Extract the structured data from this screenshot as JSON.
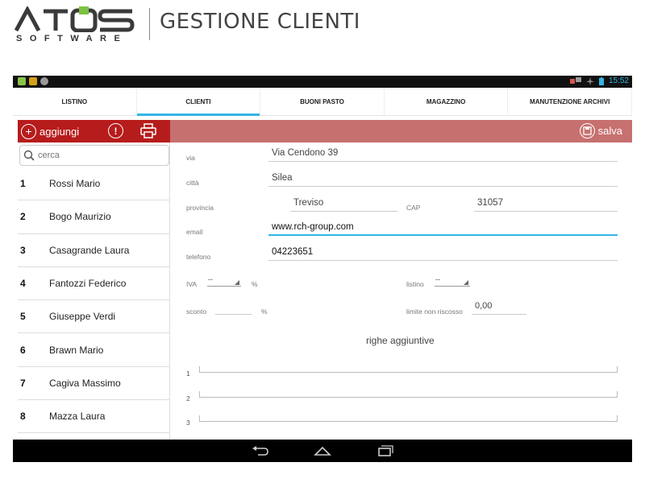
{
  "banner": {
    "logo_top": "ATOS",
    "logo_bottom": "SOFTWARE",
    "title": "GESTIONE CLIENTI"
  },
  "statusbar": {
    "time": "15:52"
  },
  "tabs": [
    {
      "label": "LISTINO",
      "active": false
    },
    {
      "label": "CLIENTI",
      "active": true
    },
    {
      "label": "BUONI PASTO",
      "active": false
    },
    {
      "label": "MAGAZZINO",
      "active": false
    },
    {
      "label": "MANUTENZIONE ARCHIVI",
      "active": false
    }
  ],
  "toolbar": {
    "add_label": "aggiungi",
    "save_label": "salva"
  },
  "search": {
    "placeholder": "cerca"
  },
  "clients": [
    {
      "num": "1",
      "name": "Rossi Mario"
    },
    {
      "num": "2",
      "name": "Bogo Maurizio"
    },
    {
      "num": "3",
      "name": "Casagrande Laura"
    },
    {
      "num": "4",
      "name": "Fantozzi Federico"
    },
    {
      "num": "5",
      "name": "Giuseppe Verdi"
    },
    {
      "num": "6",
      "name": "Brawn Mario"
    },
    {
      "num": "7",
      "name": "Cagiva Massimo"
    },
    {
      "num": "8",
      "name": "Mazza Laura"
    }
  ],
  "form": {
    "via": {
      "label": "via",
      "value": "Via Cendono 39"
    },
    "citta": {
      "label": "città",
      "value": "Silea"
    },
    "provincia": {
      "label": "provincia",
      "value": "Treviso"
    },
    "cap": {
      "label": "CAP",
      "value": "31057"
    },
    "email": {
      "label": "email",
      "value": "www.rch-group.com"
    },
    "telefono": {
      "label": "telefono",
      "value": "04223651"
    },
    "iva": {
      "label": "IVA",
      "value": "--",
      "unit": "%"
    },
    "listino": {
      "label": "listino",
      "value": "--"
    },
    "sconto": {
      "label": "sconto",
      "value": "",
      "unit": "%"
    },
    "limite": {
      "label": "limite non riscosso",
      "value": "0,00"
    },
    "righe_title": "righe aggiuntive",
    "righe": [
      "1",
      "2",
      "3"
    ]
  },
  "colors": {
    "accent": "#33b5e5",
    "toolbar_left": "#b71c1c",
    "toolbar_right": "#c77070"
  }
}
